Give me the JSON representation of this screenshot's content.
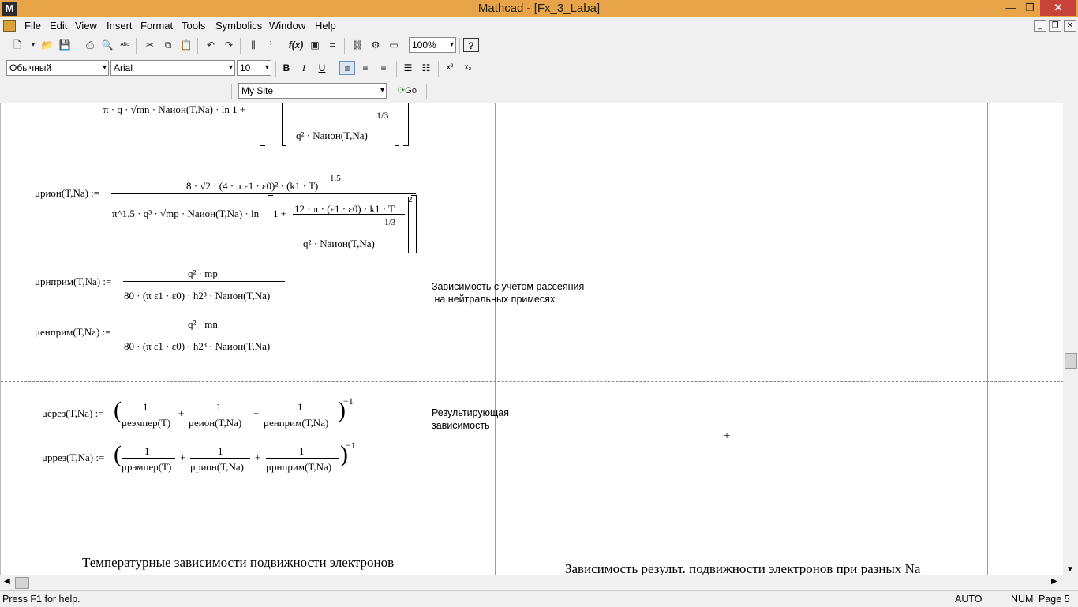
{
  "window": {
    "title": "Mathcad - [Fx_3_Laba]",
    "app_icon": "M"
  },
  "menu": [
    "File",
    "Edit",
    "View",
    "Insert",
    "Format",
    "Tools",
    "Symbolics",
    "Window",
    "Help"
  ],
  "toolbar": {
    "zoom": "100%",
    "style": "Обычный",
    "font": "Arial",
    "size": "10",
    "site": "My Site",
    "go_label": "Go",
    "help_label": "?"
  },
  "document": {
    "eq_top_fragment": "π    ·  q  ·  √mn  ·  Nаион(T,Na)  ·  ln  1 +",
    "eq_top_denominator": "q² · Nаион(T,Na)",
    "eq_top_exp": "1/3",
    "eq1": {
      "lhs": "μрион(T,Na) :=",
      "numerator": "8 · √2 · (4 · π ε1 · ε0)² · (k1 · T)",
      "num_exp": "1.5",
      "denominator": "π^1.5 · q³ · √mp · Nаион(T,Na) · ln",
      "inner_num": "12 · π · (ε1 · ε0) · k1 · T",
      "inner_den": "q² · Nаион(T,Na)",
      "inner_exp": "1/3",
      "bracket_exp": "2"
    },
    "eq2": {
      "lhs": "μрнприм(T,Na) :=",
      "numerator": "q² · mp",
      "denominator": "80 · (π ε1 · ε0) · h2³ · Nаион(T,Na)"
    },
    "eq3": {
      "lhs": "μенприм(T,Na) :=",
      "numerator": "q² · mn",
      "denominator": "80 · (π ε1 · ε0) · h2³ · Nаион(T,Na)"
    },
    "note1": "Зависимость с учетом рассеяния\n на нейтральных примесях",
    "eq4": {
      "lhs": "μерез(T,Na) :=",
      "terms": [
        "μеэмпер(T)",
        "μеион(T,Na)",
        "μенприм(T,Na)"
      ],
      "power": "−1"
    },
    "eq5": {
      "lhs": "μррез(T,Na) :=",
      "terms": [
        "μрэмпер(T)",
        "μрион(T,Na)",
        "μрнприм(T,Na)"
      ],
      "power": "−1"
    },
    "one": "1",
    "plus": "+",
    "note2": "Результирующая\nзависимость",
    "heading1": "Температурные зависимости подвижности электронов",
    "heading2": "Зависимость результ. подвижности электронов при разных Na"
  },
  "status": {
    "help": "Press F1 for help.",
    "mode": "AUTO",
    "num": "NUM",
    "page": "Page 5"
  }
}
